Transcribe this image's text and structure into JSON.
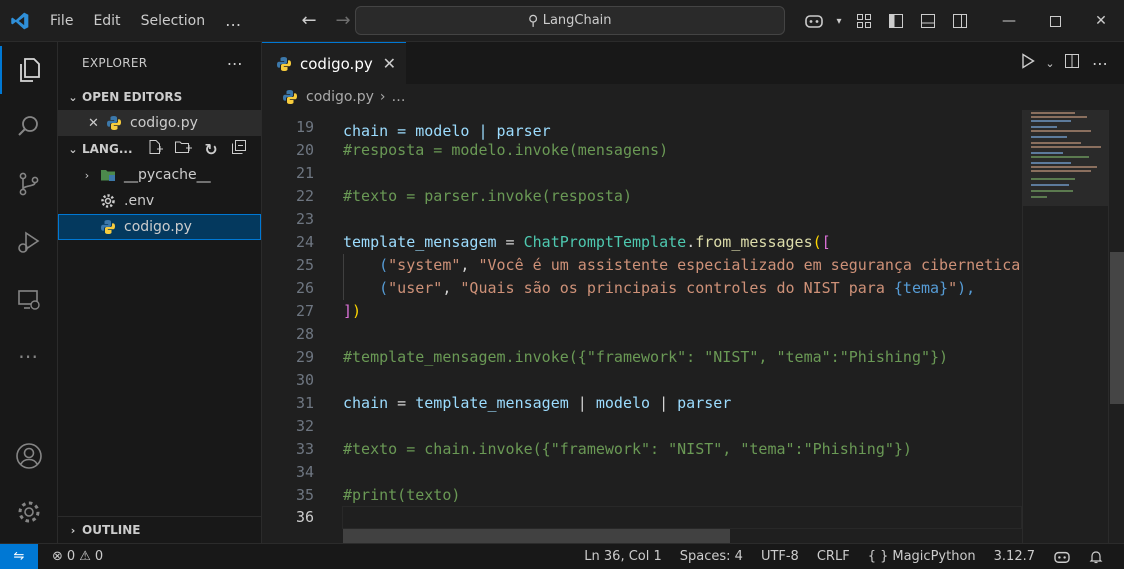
{
  "menu": {
    "file": "File",
    "edit": "Edit",
    "selection": "Selection",
    "more": "…"
  },
  "command_center": {
    "text": "LangChain"
  },
  "explorer": {
    "title": "EXPLORER",
    "open_editors_label": "OPEN EDITORS",
    "open_editor_file": "codigo.py",
    "folder_label": "LANG...",
    "items": [
      {
        "label": "__pycache__"
      },
      {
        "label": ".env"
      },
      {
        "label": "codigo.py"
      }
    ],
    "outline_label": "OUTLINE"
  },
  "tab": {
    "label": "codigo.py"
  },
  "breadcrumb": {
    "file": "codigo.py",
    "sep": "›",
    "more": "…"
  },
  "code": {
    "partial_top": "chain = modelo | parser",
    "lines": [
      {
        "n": "19"
      },
      {
        "n": "20",
        "comment": "#resposta = modelo.invoke(mensagens)"
      },
      {
        "n": "21"
      },
      {
        "n": "22",
        "comment": "#texto = parser.invoke(resposta)"
      },
      {
        "n": "23"
      },
      {
        "n": "24",
        "var": "template_mensagem",
        "eq": " = ",
        "cls": "ChatPromptTemplate",
        "dot": ".",
        "fn": "from_messages",
        "p": "(",
        "b": "["
      },
      {
        "n": "25",
        "indent": "    ",
        "p": "(",
        "s1": "\"system\"",
        "comma": ", ",
        "s2": "\"Você é um assistente especializado em segurança ciberneticа"
      },
      {
        "n": "26",
        "indent": "    ",
        "p": "(",
        "s1": "\"user\"",
        "comma": ", ",
        "s2": "\"Quais são os principais controles do NIST para ",
        "ph": "{tema}",
        "s3": "\"",
        "close": "),"
      },
      {
        "n": "27",
        "b": "]",
        "p": ")"
      },
      {
        "n": "28"
      },
      {
        "n": "29",
        "comment": "#template_mensagem.invoke({\"framework\": \"NIST\", \"tema\":\"Phishing\"})"
      },
      {
        "n": "30"
      },
      {
        "n": "31",
        "v1": "chain",
        "eq": " = ",
        "v2": "template_mensagem",
        "pipe": " | ",
        "v3": "modelo",
        "v4": "parser"
      },
      {
        "n": "32"
      },
      {
        "n": "33",
        "comment": "#texto = chain.invoke({\"framework\": \"NIST\", \"tema\":\"Phishing\"})"
      },
      {
        "n": "34"
      },
      {
        "n": "35",
        "comment": "#print(texto)"
      },
      {
        "n": "36"
      }
    ]
  },
  "status": {
    "errors": "0",
    "warnings": "0",
    "position": "Ln 36, Col 1",
    "spaces": "Spaces: 4",
    "encoding": "UTF-8",
    "eol": "CRLF",
    "language": "MagicPython",
    "lang_glyph": "{ }",
    "python_version": "3.12.7"
  },
  "colors": {
    "accent": "#0078d4",
    "comment": "#6a9955",
    "string": "#ce9178",
    "variable": "#9cdcfe",
    "class": "#4ec9b0",
    "function": "#dcdcaa"
  }
}
